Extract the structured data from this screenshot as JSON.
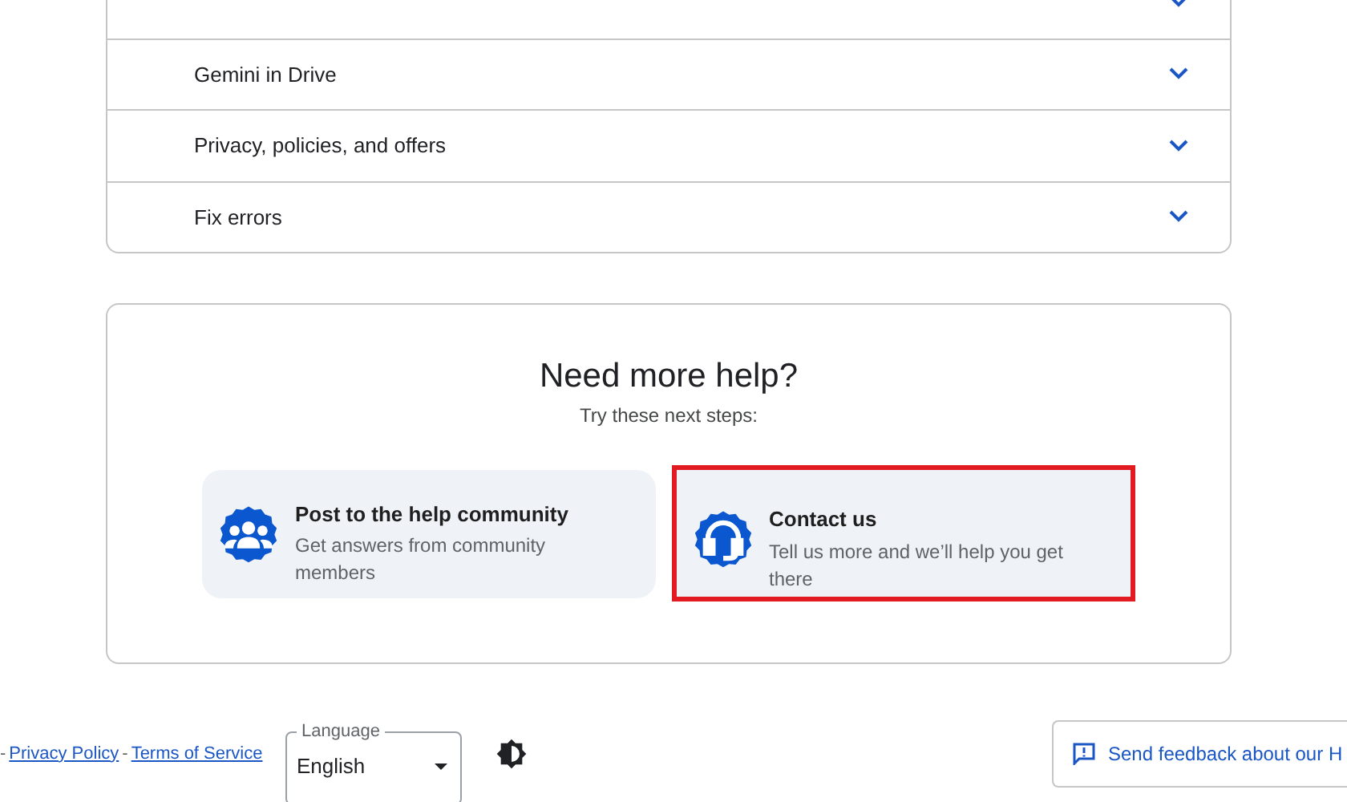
{
  "faq_items": [
    {
      "expanded": false
    },
    {
      "label": "Gemini in Drive",
      "expanded": false
    },
    {
      "label": "Privacy, policies, and offers",
      "expanded": false
    },
    {
      "label": "Fix errors",
      "expanded": false
    }
  ],
  "help": {
    "title": "Need more help?",
    "subtitle": "Try these next steps:",
    "options": [
      {
        "kind": "community",
        "title": "Post to the help community",
        "description": "Get answers from community members",
        "highlighted": false
      },
      {
        "kind": "contact",
        "title": "Contact us",
        "description": "Tell us more and we’ll help you get there",
        "highlighted": true
      }
    ]
  },
  "footer": {
    "links": [
      {
        "separator": "-",
        "label": "Privacy Policy"
      },
      {
        "separator": "-",
        "label": "Terms of Service"
      }
    ],
    "language": {
      "label": "Language",
      "value": "English"
    },
    "feedback": "Send feedback about our H"
  }
}
